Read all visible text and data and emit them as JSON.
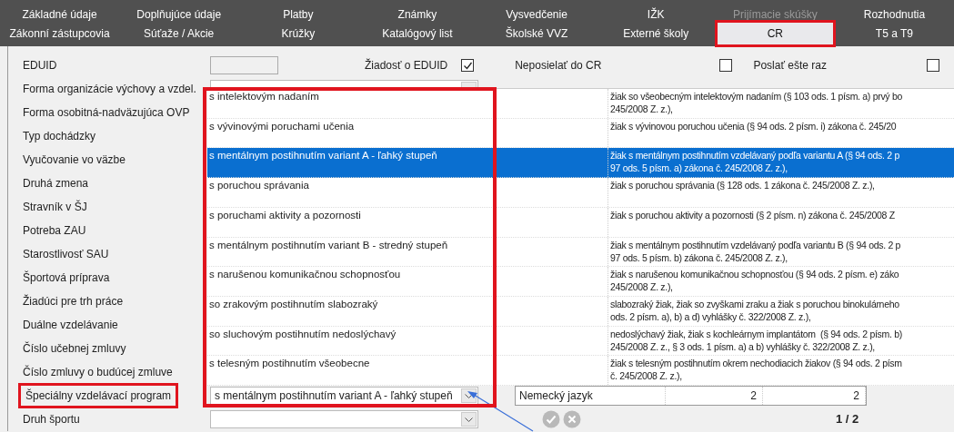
{
  "tab_rows": [
    {
      "tabs": [
        {
          "label": "Základné údaje",
          "selected": false,
          "disabled": false,
          "highlighted": false
        },
        {
          "label": "Doplňujúce údaje",
          "selected": false,
          "disabled": false,
          "highlighted": false
        },
        {
          "label": "Platby",
          "selected": false,
          "disabled": false,
          "highlighted": false
        },
        {
          "label": "Známky",
          "selected": false,
          "disabled": false,
          "highlighted": false
        },
        {
          "label": "Vysvedčenie",
          "selected": false,
          "disabled": false,
          "highlighted": false
        },
        {
          "label": "IŽK",
          "selected": false,
          "disabled": false,
          "highlighted": false
        },
        {
          "label": "Prijímacie skúšky",
          "selected": false,
          "disabled": true,
          "highlighted": false
        },
        {
          "label": "Rozhodnutia",
          "selected": false,
          "disabled": false,
          "highlighted": false
        }
      ]
    },
    {
      "tabs": [
        {
          "label": "Zákonní zástupcovia",
          "selected": false,
          "disabled": false,
          "highlighted": false
        },
        {
          "label": "Súťaže / Akcie",
          "selected": false,
          "disabled": false,
          "highlighted": false
        },
        {
          "label": "Krúžky",
          "selected": false,
          "disabled": false,
          "highlighted": false
        },
        {
          "label": "Katalógový list",
          "selected": false,
          "disabled": false,
          "highlighted": false
        },
        {
          "label": "Školské VVZ",
          "selected": false,
          "disabled": false,
          "highlighted": false
        },
        {
          "label": "Externé školy",
          "selected": false,
          "disabled": false,
          "highlighted": false
        },
        {
          "label": "CR",
          "selected": true,
          "disabled": false,
          "highlighted": true
        },
        {
          "label": "T5 a T9",
          "selected": false,
          "disabled": false,
          "highlighted": false
        }
      ]
    }
  ],
  "form": {
    "rows": [
      {
        "label": "EDUID",
        "highlighted": false,
        "kind": "text",
        "value": "",
        "checkboxes": [
          {
            "label": "Žiadosť o EDUID",
            "checked": true
          },
          {
            "label": "Neposielať do CR",
            "checked": false
          },
          {
            "label": "Poslať ešte raz",
            "checked": false
          }
        ]
      },
      {
        "label": "Forma organizácie výchovy a vzdel.",
        "highlighted": false,
        "kind": "combo",
        "value": ""
      },
      {
        "label": "Forma osobitná-nadväzujúca OVP",
        "highlighted": false,
        "kind": "none"
      },
      {
        "label": "Typ dochádzky",
        "highlighted": false,
        "kind": "none"
      },
      {
        "label": "Vyučovanie vo väzbe",
        "highlighted": false,
        "kind": "none"
      },
      {
        "label": "Druhá zmena",
        "highlighted": false,
        "kind": "none"
      },
      {
        "label": "Stravník v ŠJ",
        "highlighted": false,
        "kind": "none"
      },
      {
        "label": "Potreba ZAU",
        "highlighted": false,
        "kind": "none"
      },
      {
        "label": "Starostlivosť SAU",
        "highlighted": false,
        "kind": "none"
      },
      {
        "label": "Športová príprava",
        "highlighted": false,
        "kind": "none"
      },
      {
        "label": "Žiadúci pre trh práce",
        "highlighted": false,
        "kind": "none"
      },
      {
        "label": "Duálne vzdelávanie",
        "highlighted": false,
        "kind": "none"
      },
      {
        "label": "Číslo učebnej zmluvy",
        "highlighted": false,
        "kind": "none"
      },
      {
        "label": "Číslo zmluvy o budúcej zmluve",
        "highlighted": false,
        "kind": "none"
      },
      {
        "label": "Špeciálny vzdelávací program",
        "highlighted": true,
        "kind": "combo",
        "value": "s mentálnym postihnutím variant A - ľahký stupeň"
      },
      {
        "label": "Druh športu",
        "highlighted": false,
        "kind": "combo",
        "value": ""
      }
    ]
  },
  "dropdown": {
    "highlighted": true,
    "options": [
      {
        "label": "s intelektovým nadaním",
        "selected": false,
        "description_lines": [
          "žiak so všeobecným intelektovým nadaním (§ 103 ods. 1 písm. a) prvý bo",
          "245/2008 Z. z.),"
        ]
      },
      {
        "label": "s vývinovými poruchami učenia",
        "selected": false,
        "description_lines": [
          "žiak s vývinovou poruchou učenia (§ 94 ods. 2 písm. i) zákona č. 245/20"
        ]
      },
      {
        "label": "s mentálnym postihnutím variant A - ľahký stupeň",
        "selected": true,
        "description_lines": [
          "žiak s mentálnym postihnutím vzdelávaný podľa variantu A (§ 94 ods. 2 p",
          "97 ods. 5 písm. a) zákona č. 245/2008 Z. z.),"
        ]
      },
      {
        "label": "s poruchou správania",
        "selected": false,
        "description_lines": [
          "žiak s poruchou správania (§ 128 ods. 1 zákona č. 245/2008 Z. z.),"
        ]
      },
      {
        "label": "s poruchami aktivity a pozornosti",
        "selected": false,
        "description_lines": [
          "žiak s poruchou aktivity a pozornosti (§ 2 písm. n) zákona č. 245/2008 Z"
        ]
      },
      {
        "label": "s mentálnym postihnutím variant B - stredný stupeň",
        "selected": false,
        "description_lines": [
          "žiak s mentálnym postihnutím vzdelávaný podľa variantu B (§ 94 ods. 2 p",
          "97 ods. 5 písm. b) zákona č. 245/2008 Z. z.),"
        ]
      },
      {
        "label": "s narušenou komunikačnou schopnosťou",
        "selected": false,
        "description_lines": [
          "žiak s narušenou komunikačnou schopnosťou (§ 94 ods. 2 písm. e) záko",
          "245/2008 Z. z.),"
        ]
      },
      {
        "label": "so zrakovým postihnutím slabozraký",
        "selected": false,
        "description_lines": [
          "slabozraký žiak, žiak so zvyškami zraku a žiak s poruchou binokulárneho",
          "ods. 2 písm. a), b) a d) vyhlášky č. 322/2008 Z. z.),"
        ]
      },
      {
        "label": "so sluchovým postihnutím nedoslýchavý",
        "selected": false,
        "description_lines": [
          "nedoslýchavý žiak, žiak s kochleárnym implantátom  (§ 94 ods. 2 písm. b)",
          "245/2008 Z. z., § 3 ods. 1 písm. a) a b) vyhlášky č. 322/2008 Z. z.),"
        ]
      },
      {
        "label": "s telesným postihnutím všeobecne",
        "selected": false,
        "description_lines": [
          "žiak s telesným postihnutím okrem nechodiacich žiakov (§ 94 ods. 2 písm",
          "č. 245/2008 Z. z.),"
        ]
      }
    ]
  },
  "language_grid": {
    "rows": [
      {
        "cells": [
          "Nemecký jazyk",
          "2",
          "2"
        ]
      }
    ]
  },
  "pager": "1 / 2"
}
